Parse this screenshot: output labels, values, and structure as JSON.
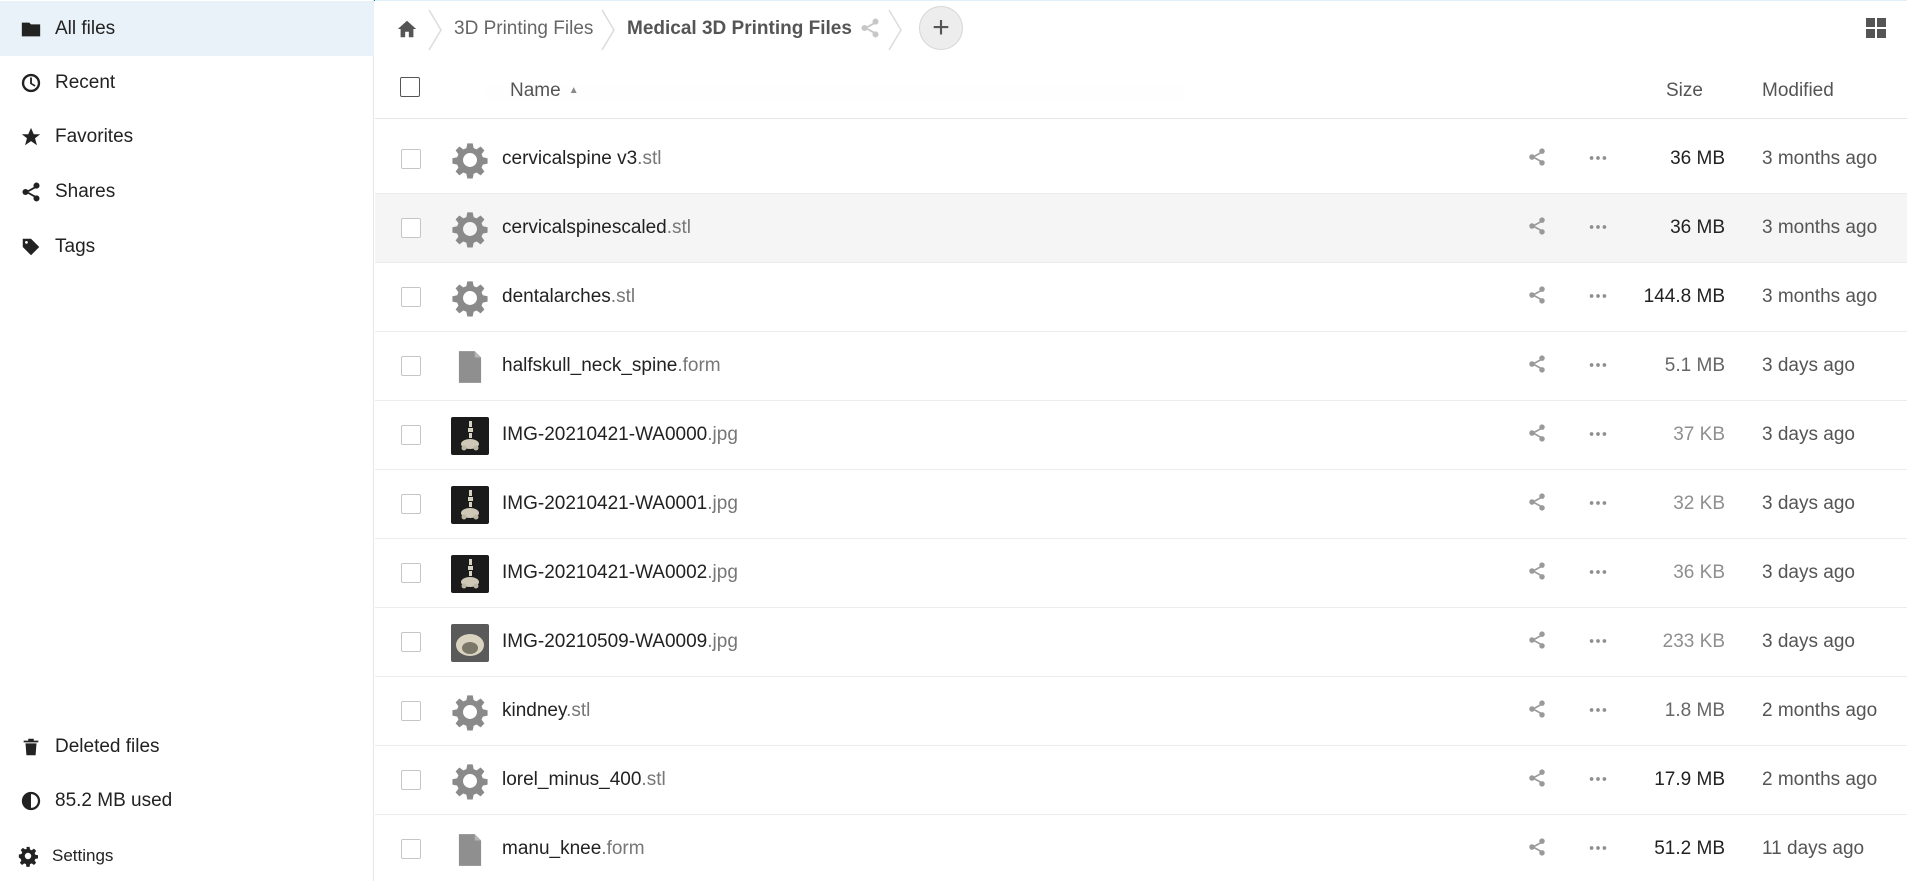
{
  "colors": {
    "accent": "#0082c9",
    "active_bg": "#e9f2f9",
    "row_hover": "#f5f5f5"
  },
  "sidebar": {
    "items": [
      {
        "label": "All files",
        "icon": "folder-icon",
        "active": true
      },
      {
        "label": "Recent",
        "icon": "clock-icon"
      },
      {
        "label": "Favorites",
        "icon": "star-icon"
      },
      {
        "label": "Shares",
        "icon": "share-icon"
      },
      {
        "label": "Tags",
        "icon": "tag-icon"
      }
    ],
    "footer": [
      {
        "label": "Deleted files",
        "icon": "trash-icon"
      },
      {
        "label": "85.2 MB used",
        "icon": "quota-pie-icon"
      },
      {
        "label": "Settings",
        "icon": "gear-icon"
      }
    ]
  },
  "breadcrumb": {
    "home_icon": "home-icon",
    "items": [
      "3D Printing Files",
      "Medical 3D Printing Files"
    ]
  },
  "controls": {
    "new_label": "+"
  },
  "header": {
    "name": "Name",
    "size": "Size",
    "modified": "Modified"
  },
  "files": [
    {
      "base": "cervicalspine v3",
      "ext": ".stl",
      "size": "36 MB",
      "modified": "3 months ago",
      "icon": "gear-file-icon"
    },
    {
      "base": "cervicalspinescaled",
      "ext": ".stl",
      "size": "36 MB",
      "modified": "3 months ago",
      "icon": "gear-file-icon",
      "highlighted": true
    },
    {
      "base": "dentalarches",
      "ext": ".stl",
      "size": "144.8 MB",
      "modified": "3 months ago",
      "icon": "gear-file-icon"
    },
    {
      "base": "halfskull_neck_spine",
      "ext": ".form",
      "size": "5.1 MB",
      "modified": "3 days ago",
      "icon": "document-icon"
    },
    {
      "base": "IMG-20210421-WA0000",
      "ext": ".jpg",
      "size": "37 KB",
      "modified": "3 days ago",
      "icon": "image-thumbnail-spine"
    },
    {
      "base": "IMG-20210421-WA0001",
      "ext": ".jpg",
      "size": "32 KB",
      "modified": "3 days ago",
      "icon": "image-thumbnail-spine"
    },
    {
      "base": "IMG-20210421-WA0002",
      "ext": ".jpg",
      "size": "36 KB",
      "modified": "3 days ago",
      "icon": "image-thumbnail-spine"
    },
    {
      "base": "IMG-20210509-WA0009",
      "ext": ".jpg",
      "size": "233 KB",
      "modified": "3 days ago",
      "icon": "image-thumbnail-dental"
    },
    {
      "base": "kindney",
      "ext": ".stl",
      "size": "1.8 MB",
      "modified": "2 months ago",
      "icon": "gear-file-icon"
    },
    {
      "base": "lorel_minus_400",
      "ext": ".stl",
      "size": "17.9 MB",
      "modified": "2 months ago",
      "icon": "gear-file-icon"
    },
    {
      "base": "manu_knee",
      "ext": ".form",
      "size": "51.2 MB",
      "modified": "11 days ago",
      "icon": "document-icon"
    }
  ]
}
